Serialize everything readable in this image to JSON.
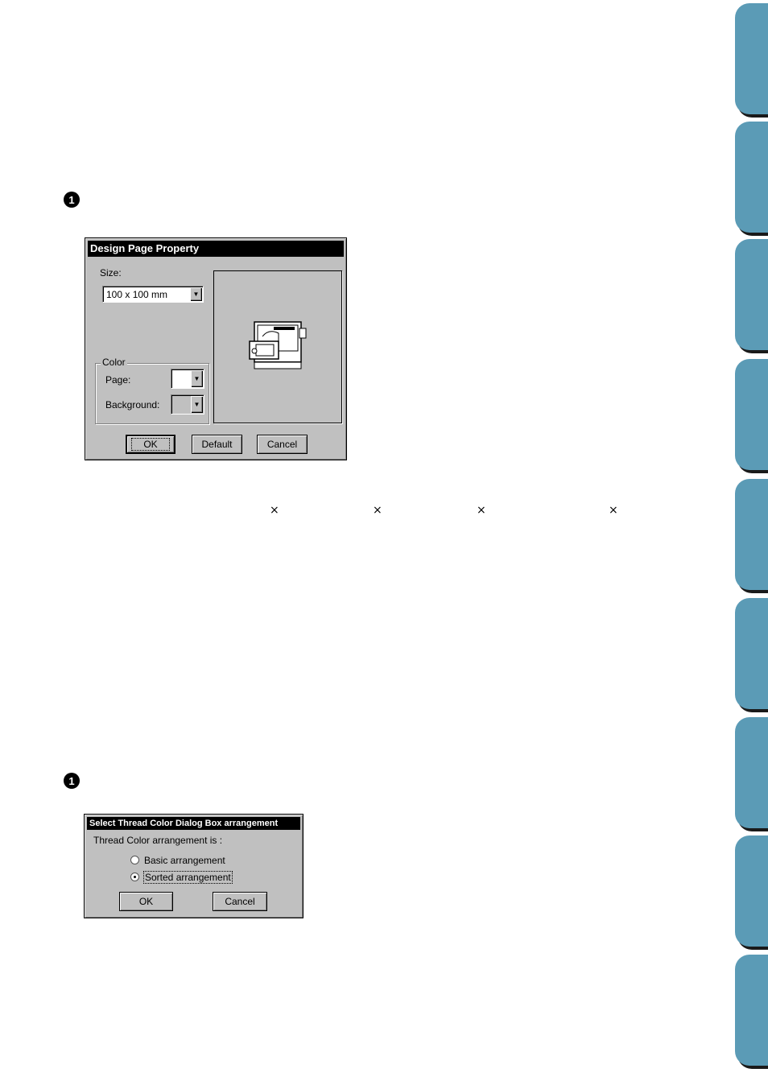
{
  "page": {
    "step1_marker": "1",
    "step2_marker": "1",
    "multiplication_signs": [
      "×",
      "×",
      "×",
      "×"
    ]
  },
  "design_page_dialog": {
    "title": "Design Page Property",
    "size_label": "Size:",
    "size_value": "100 x 100 mm",
    "color_group_label": "Color",
    "page_label": "Page:",
    "background_label": "Background:",
    "page_color": "#ffffff",
    "background_color": "#c0c0c0",
    "preview_icon": "sewing-machine-icon",
    "ok_label": "OK",
    "default_label": "Default",
    "cancel_label": "Cancel"
  },
  "thread_color_dialog": {
    "title": "Select Thread Color Dialog Box arrangement",
    "prompt": "Thread Color arrangement is :",
    "options": [
      {
        "label": "Basic arrangement",
        "checked": false
      },
      {
        "label": "Sorted arrangement",
        "checked": true
      }
    ],
    "ok_label": "OK",
    "cancel_label": "Cancel"
  },
  "side_tabs": {
    "count": 9,
    "color": "#5b9bb6"
  }
}
